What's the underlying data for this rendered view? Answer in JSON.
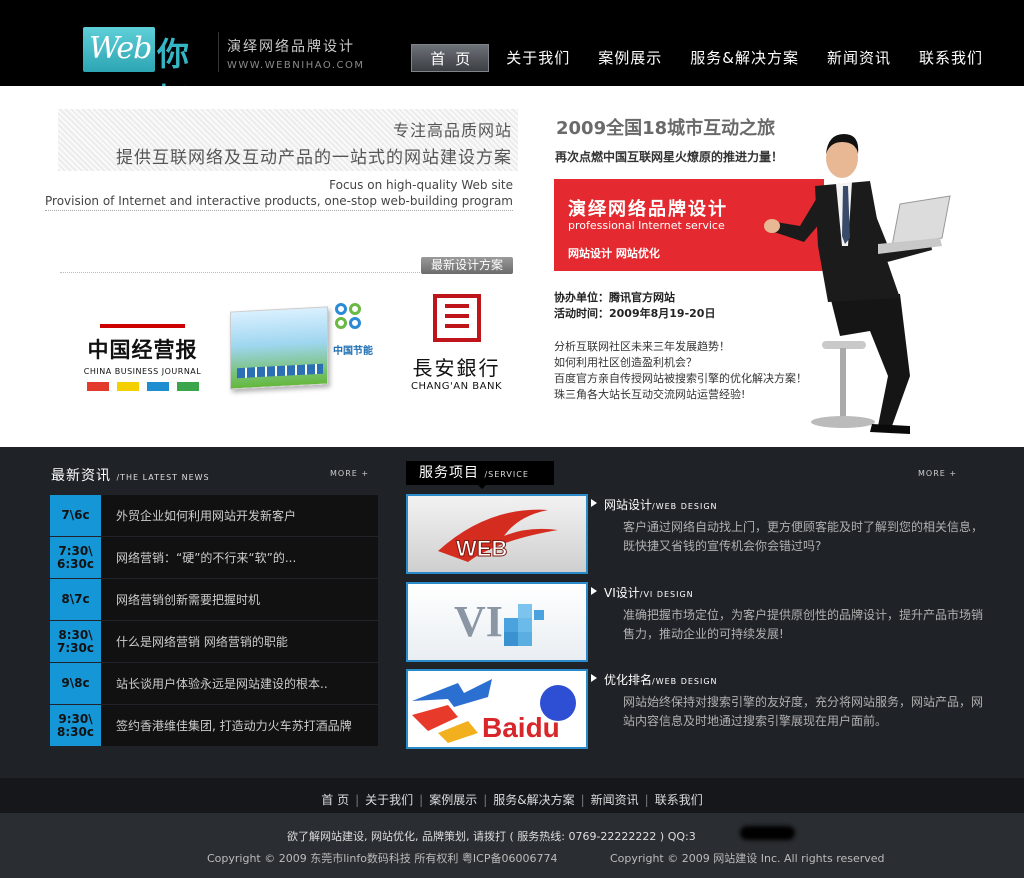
{
  "header": {
    "logo_web": "Web",
    "logo_cn": "你好",
    "site_title": "演绎网络品牌设计",
    "site_url": "WWW.WEBNIHAO.COM",
    "nav": [
      {
        "label": "首页"
      },
      {
        "label": "关于我们"
      },
      {
        "label": "案例展示"
      },
      {
        "label": "服务&解决方案"
      },
      {
        "label": "新闻资讯"
      },
      {
        "label": "联系我们"
      }
    ]
  },
  "banner": {
    "tag_line1": "专注高品质网站",
    "tag_line2": "提供互联网络及互动产品的一站式的网站建设方案",
    "en_line1": "Focus on high-quality Web site",
    "en_line2": "Provision of Internet and interactive products, one-stop web-building program",
    "latest_btn": "最新设计方案",
    "clients": {
      "cbj_cn": "中国经营报",
      "cbj_en": "CHINA BUSINESS JOURNAL",
      "energy_name": "中国节能",
      "bank_cn": "長安銀行",
      "bank_en": "CHANG'AN BANK"
    },
    "promo": {
      "title": "2009全国18城市互动之旅",
      "subtitle": "再次点燃中国互联网星火燎原的推进力量！",
      "red_cn": "演绎网络品牌设计",
      "red_en": "professional Internet service",
      "red_tags": "网站设计  网站优化",
      "organizer_label": "协办单位：",
      "organizer": "腾讯官方网站",
      "time_label": "活动时间：",
      "time": "2009年8月19-20日",
      "points": [
        "分析互联网社区未来三年发展趋势！",
        "如何利用社区创造盈利机会？",
        "百度官方亲自传授网站被搜索引擎的优化解决方案！",
        "珠三角各大站长互动交流网站运营经验!"
      ]
    }
  },
  "news": {
    "title": "最新资讯",
    "subtitle": "/THE LATEST NEWS",
    "more": "MORE +",
    "items": [
      {
        "date": "7\\6c",
        "title": "外贸企业如何利用网站开发新客户"
      },
      {
        "date": "7:30\\\n6:30c",
        "title": "网络营销：“硬”的不行来“软”的..."
      },
      {
        "date": "8\\7c",
        "title": "网络营销创新需要把握时机"
      },
      {
        "date": "8:30\\\n7:30c",
        "title": "什么是网络营销  网络营销的职能"
      },
      {
        "date": "9\\8c",
        "title": "站长谈用户体验永远是网站建设的根本.."
      },
      {
        "date": "9:30\\\n8:30c",
        "title": "签约香港维佳集团, 打造动力火车苏打酒品牌"
      }
    ]
  },
  "services": {
    "title": "服务项目",
    "subtitle": "/SERVICE",
    "more": "MORE +",
    "items": [
      {
        "title": "网站设计",
        "en": "/WEB DESIGN",
        "desc": "客户通过网络自动找上门，更方便顾客能及时了解到您的相关信息，既快捷又省钱的宣传机会你会错过吗?",
        "thumb_text": "WEB"
      },
      {
        "title": "VI设计",
        "en": "/VI DESIGN",
        "desc": "准确把握市场定位，为客户提供原创性的品牌设计，提升产品市场销售力，推动企业的可持续发展!",
        "thumb_text": "VI"
      },
      {
        "title": "优化排名",
        "en": "/WEB DESIGN",
        "desc": "网站始终保持对搜索引擎的友好度，充分将网站服务，网站产品，网站内容信息及时地通过搜索引擎展现在用户面前。",
        "thumb_text": "Baidu"
      }
    ]
  },
  "footer": {
    "nav": [
      "首  页",
      "关于我们",
      "案例展示",
      "服务&解决方案",
      "新闻资讯",
      "联系我们"
    ],
    "line1": "欲了解网站建设, 网站优化, 品牌策划, 请拨打 ( 服务热线: 0769-22222222    )         QQ:3",
    "line2": "Copyright © 2009  东莞市linfo数码科技 所有权利 粤ICP备06006774",
    "line3": "Copyright © 2009 网站建设 Inc. All rights reserved"
  },
  "colors": {
    "accent_blue": "#1596d6",
    "promo_red": "#e42a30",
    "logo_teal": "#35b6c4"
  }
}
